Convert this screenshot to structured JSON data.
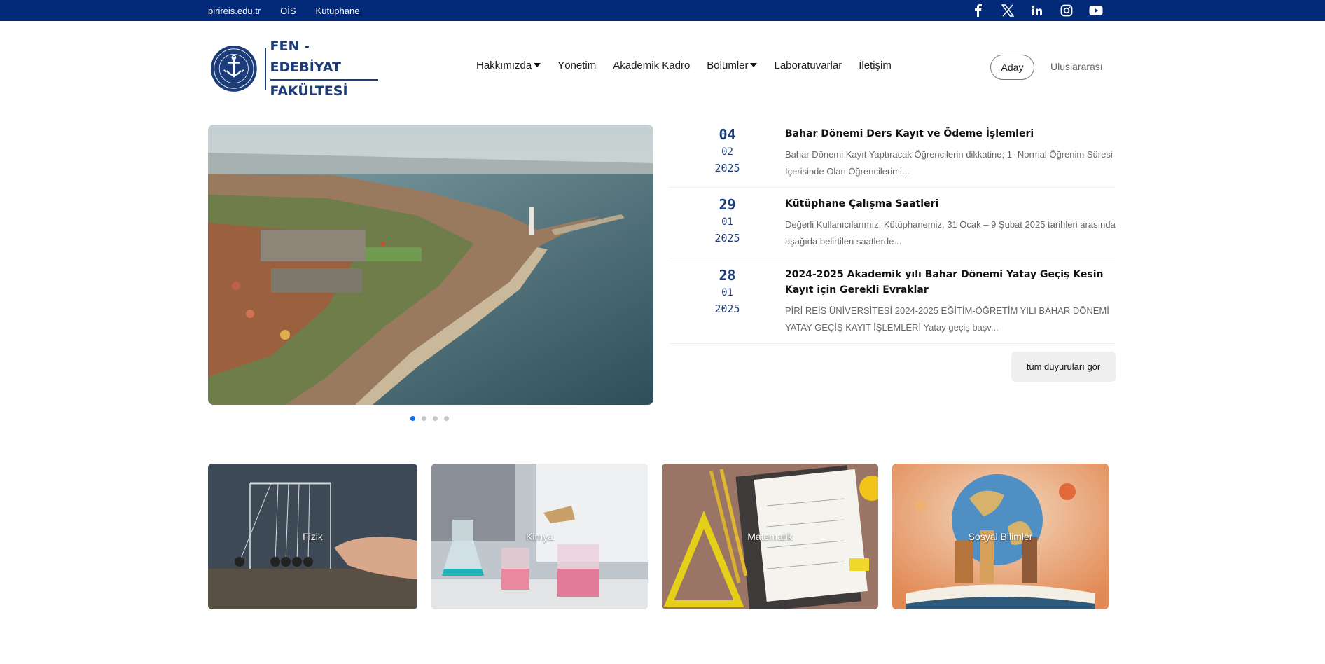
{
  "topbar": {
    "links": [
      "pirireis.edu.tr",
      "OİS",
      "Kütüphane"
    ],
    "social_icons": [
      "facebook-icon",
      "x-icon",
      "linkedin-icon",
      "instagram-icon",
      "youtube-icon"
    ]
  },
  "logo": {
    "seal_text": "PİRİ REİS ÜNİVERSİTESİ",
    "seal_year": "2008",
    "line1": "FEN - EDEBİYAT",
    "line2": "FAKÜLTESİ"
  },
  "nav": {
    "items": [
      {
        "label": "Hakkımızda",
        "dropdown": true
      },
      {
        "label": "Yönetim",
        "dropdown": false
      },
      {
        "label": "Akademik Kadro",
        "dropdown": false
      },
      {
        "label": "Bölümler",
        "dropdown": true
      },
      {
        "label": "Laboratuvarlar",
        "dropdown": false
      },
      {
        "label": "İletişim",
        "dropdown": false
      }
    ],
    "aday": "Aday",
    "international": "Uluslararası"
  },
  "slider": {
    "active_index": 0,
    "count": 4
  },
  "announcements": {
    "items": [
      {
        "day": "04",
        "month": "02",
        "year": "2025",
        "title": "Bahar Dönemi Ders Kayıt ve Ödeme İşlemleri",
        "excerpt": "Bahar Dönemi Kayıt Yaptıracak Öğrencilerin dikkatine;   1- Normal Öğrenim Süresi İçerisinde Olan Öğrencilerimi..."
      },
      {
        "day": "29",
        "month": "01",
        "year": "2025",
        "title": "Kütüphane Çalışma Saatleri",
        "excerpt": "Değerli Kullanıcılarımız, Kütüphanemiz, 31 Ocak – 9 Şubat 2025 tarihleri arasında aşağıda belirtilen saatlerde..."
      },
      {
        "day": "28",
        "month": "01",
        "year": "2025",
        "title": "2024-2025 Akademik yılı Bahar Dönemi Yatay Geçiş Kesin Kayıt için Gerekli Evraklar",
        "excerpt": "PİRİ REİS ÜNİVERSİTESİ 2024-2025 EĞİTİM-ÖĞRETİM YILI BAHAR DÖNEMİ YATAY GEÇİŞ KAYIT İŞLEMLERİ Yatay geçiş başv..."
      }
    ],
    "all_button": "tüm duyuruları gör"
  },
  "departments": [
    {
      "label": "Fizik"
    },
    {
      "label": "Kimya"
    },
    {
      "label": "Matematik"
    },
    {
      "label": "Sosyal Bilimler"
    }
  ]
}
